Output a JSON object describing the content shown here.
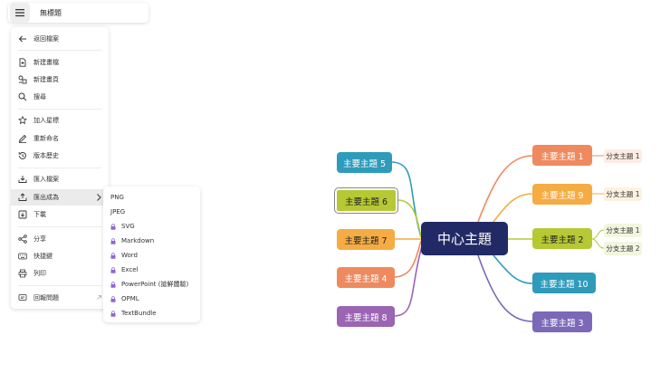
{
  "header": {
    "title": "無標題",
    "menu_icon": "hamburger-icon"
  },
  "menu": {
    "items": [
      {
        "label": "返回檔案",
        "icon": "arrow-left-icon"
      },
      {
        "label": "新建畫檔",
        "icon": "new-file-icon"
      },
      {
        "label": "新建畫頁",
        "icon": "new-sheet-icon"
      },
      {
        "label": "搜尋",
        "icon": "search-icon"
      },
      {
        "label": "加入星標",
        "icon": "star-icon"
      },
      {
        "label": "重新命名",
        "icon": "pencil-icon"
      },
      {
        "label": "版本歷史",
        "icon": "history-icon"
      },
      {
        "label": "匯入檔案",
        "icon": "import-icon"
      },
      {
        "label": "匯出成為",
        "icon": "export-icon"
      },
      {
        "label": "下載",
        "icon": "download-icon"
      },
      {
        "label": "分享",
        "icon": "share-icon"
      },
      {
        "label": "快捷鍵",
        "icon": "keyboard-icon"
      },
      {
        "label": "列印",
        "icon": "printer-icon"
      },
      {
        "label": "回報問題",
        "icon": "feedback-icon"
      }
    ]
  },
  "export_submenu": {
    "items": [
      {
        "label": "PNG",
        "locked": false
      },
      {
        "label": "JPEG",
        "locked": false
      },
      {
        "label": "SVG",
        "locked": true
      },
      {
        "label": "Markdown",
        "locked": true
      },
      {
        "label": "Word",
        "locked": true
      },
      {
        "label": "Excel",
        "locked": true
      },
      {
        "label": "PowerPoint (搶鮮體驗)",
        "locked": true
      },
      {
        "label": "OPML",
        "locked": true
      },
      {
        "label": "TextBundle",
        "locked": true
      }
    ],
    "lock_color": "#8f66d9"
  },
  "mindmap": {
    "center": {
      "label": "中心主題",
      "color": "#222a66"
    },
    "topics": [
      {
        "label": "主要主題 1",
        "color": "#ef8a5f"
      },
      {
        "label": "主要主題 9",
        "color": "#f5ac43"
      },
      {
        "label": "主要主題 2",
        "color": "#b6c935"
      },
      {
        "label": "主要主題 10",
        "color": "#2f9bbb"
      },
      {
        "label": "主要主題 3",
        "color": "#7b69b8"
      },
      {
        "label": "主要主題 5",
        "color": "#2f9bbb"
      },
      {
        "label": "主要主題 6",
        "color": "#b6c935"
      },
      {
        "label": "主要主題 7",
        "color": "#f5ac43"
      },
      {
        "label": "主要主題 4",
        "color": "#ef8a5f"
      },
      {
        "label": "主要主題 8",
        "color": "#9b65b3"
      }
    ],
    "branches": [
      {
        "label": "分支主題 1",
        "color": "#fdece4"
      },
      {
        "label": "分支主題 1",
        "color": "#fdf1df"
      },
      {
        "label": "分支主題 1",
        "color": "#f3f6df"
      },
      {
        "label": "分支主題 2",
        "color": "#f3f6df"
      }
    ]
  }
}
